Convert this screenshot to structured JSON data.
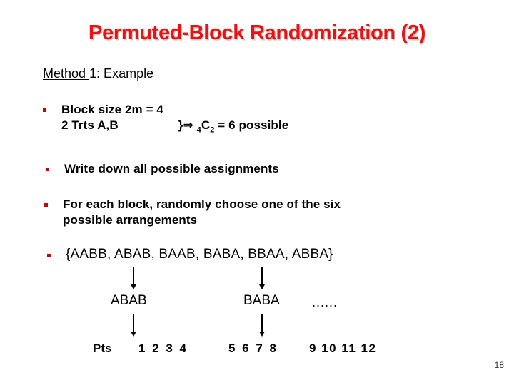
{
  "slide": {
    "title": "Permuted-Block Randomization (2)",
    "title_color": "#ee1111",
    "bullet_color": "#cc0000",
    "page_number": "18"
  },
  "method": {
    "underlined_part": "Method ",
    "rest": "1: Example"
  },
  "bullets": [
    {
      "line1": "Block size  2m = 4",
      "line2_left": "2 Trts A,B",
      "line2_brace": "}",
      "line2_implies": "⇒",
      "line2_sub_left": "4",
      "line2_c": "C",
      "line2_sub_right": "2",
      "line2_tail": "= 6 possible"
    },
    {
      "text": "Write down all possible assignments"
    },
    {
      "line1": "For each block, randomly choose one of the six",
      "line2": "possible arrangements"
    },
    {
      "text": "{AABB, ABAB, BAAB, BABA, BBAA, ABBA}"
    }
  ],
  "flow": {
    "block1": "ABAB",
    "block2": "BABA",
    "ellipsis": "......"
  },
  "pts": {
    "label": "Pts",
    "group1": "1 2 3 4",
    "group2": "5 6 7 8",
    "group3": "9 10 11 12"
  },
  "chart_data": {
    "type": "diagram",
    "title": "Permuted-Block Randomization (2)",
    "nodes": [
      {
        "id": "set",
        "label": "{AABB, ABAB, BAAB, BABA, BBAA, ABBA}"
      },
      {
        "id": "block1",
        "label": "ABAB"
      },
      {
        "id": "block2",
        "label": "BABA"
      },
      {
        "id": "pts1",
        "label": "1 2 3 4"
      },
      {
        "id": "pts2",
        "label": "5 6 7 8"
      },
      {
        "id": "pts3",
        "label": "9 10 11 12"
      }
    ],
    "edges": [
      {
        "from": "set",
        "to": "block1",
        "style": "arrow-down"
      },
      {
        "from": "set",
        "to": "block2",
        "style": "arrow-down"
      },
      {
        "from": "block1",
        "to": "pts1",
        "style": "arrow-down"
      },
      {
        "from": "block2",
        "to": "pts2",
        "style": "arrow-down"
      }
    ]
  }
}
